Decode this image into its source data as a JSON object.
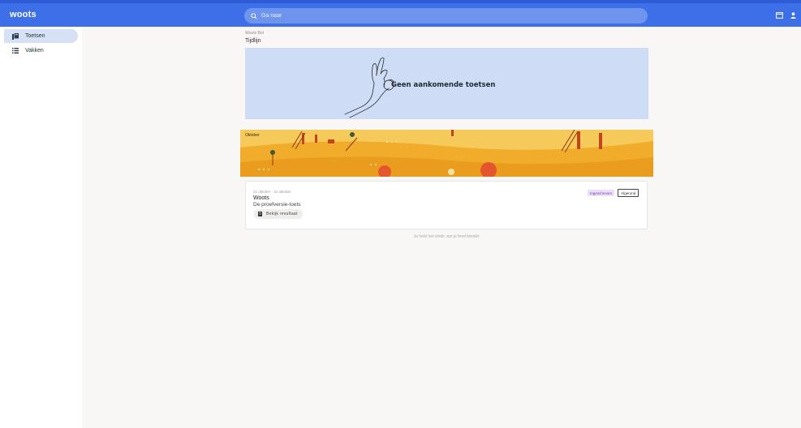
{
  "app": {
    "logo": "woots"
  },
  "search": {
    "placeholder": "Ga naar",
    "icon": "search-icon"
  },
  "topbar": {
    "icons": [
      "calendar-icon",
      "user-icon"
    ],
    "color": "#3d6fe8"
  },
  "sidebar": {
    "items": [
      {
        "label": "Toetsen",
        "icon": "tests-icon",
        "active": true
      },
      {
        "label": "Vakken",
        "icon": "list-icon",
        "active": false
      }
    ]
  },
  "main": {
    "breadcrumb": "Woots Bot",
    "timeline_title": "Tijdlijn",
    "empty_state": "Geen aankomende toetsen",
    "course": {
      "name": "Oktober"
    },
    "test": {
      "date_range": "21 oktober - 31 oktober",
      "name": "Woots",
      "subtitle": "De proefversie-toets",
      "results_button": "Bekijk resultaat",
      "badge_status": "Ingeschreven",
      "badge_action": "Afgerond"
    },
    "footer_note": "Je hebt het einde van je feed bereikt"
  }
}
